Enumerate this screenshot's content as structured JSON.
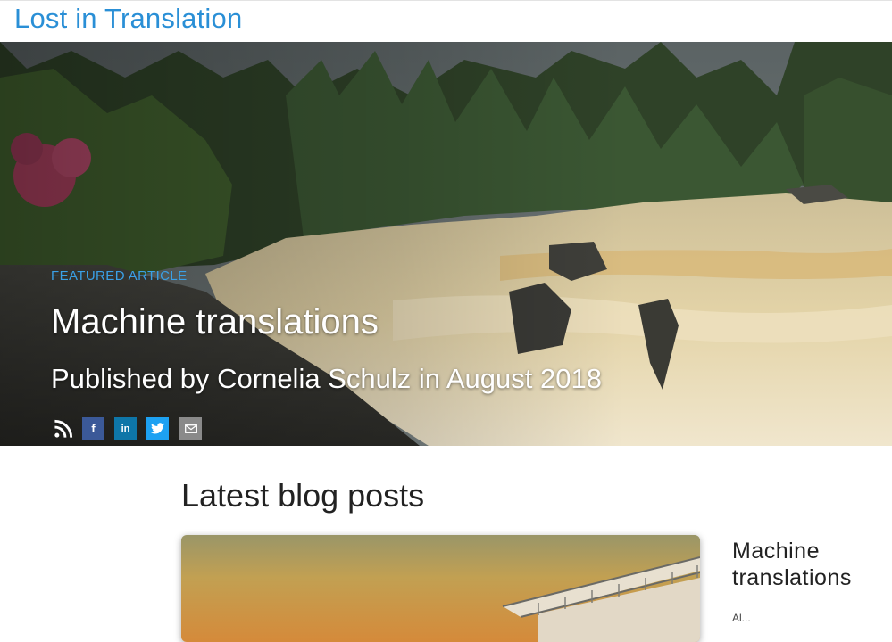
{
  "header": {
    "site_title": "Lost in Translation"
  },
  "hero": {
    "label": "FEATURED ARTICLE",
    "title": "Machine translations",
    "subtitle": "Published by Cornelia Schulz in August 2018",
    "share_icons": [
      "rss-icon",
      "facebook-icon",
      "linkedin-icon",
      "twitter-icon",
      "email-icon"
    ],
    "share_glyphs": {
      "facebook": "f",
      "linkedin": "in"
    }
  },
  "latest": {
    "heading": "Latest blog posts",
    "posts": [
      {
        "title": "Machine translations",
        "excerpt": "Al..."
      }
    ]
  },
  "colors": {
    "accent": "#2a8fd6",
    "facebook": "#3b5998",
    "linkedin": "#0e76a8",
    "twitter": "#1da1f2",
    "email": "#8a8a8a"
  }
}
